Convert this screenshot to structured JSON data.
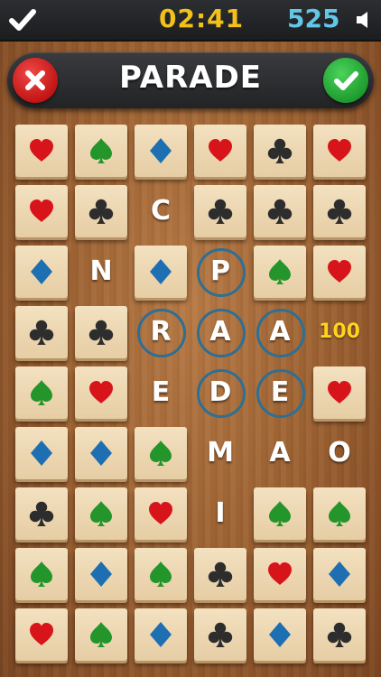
{
  "topbar": {
    "timer": "02:41",
    "score": "525"
  },
  "word": "PARADE",
  "colors": {
    "heart": "#d8141b",
    "spade": "#23952a",
    "diamond": "#1d6fb2",
    "club": "#2d2d2d",
    "timer": "#f2c21a",
    "score": "#62c6e6"
  },
  "grid": [
    [
      {
        "t": "heart"
      },
      {
        "t": "spade"
      },
      {
        "t": "diamond"
      },
      {
        "t": "heart"
      },
      {
        "t": "club"
      },
      {
        "t": "heart"
      }
    ],
    [
      {
        "t": "heart"
      },
      {
        "t": "club"
      },
      {
        "l": "C"
      },
      {
        "t": "club"
      },
      {
        "t": "club"
      },
      {
        "t": "club"
      }
    ],
    [
      {
        "t": "diamond"
      },
      {
        "l": "N"
      },
      {
        "t": "diamond"
      },
      {
        "l": "P",
        "sel": true
      },
      {
        "t": "spade"
      },
      {
        "t": "heart"
      }
    ],
    [
      {
        "t": "club"
      },
      {
        "t": "club"
      },
      {
        "l": "R",
        "sel": true
      },
      {
        "l": "A",
        "sel": true
      },
      {
        "l": "A",
        "sel": true
      },
      {
        "p": "100"
      }
    ],
    [
      {
        "t": "spade"
      },
      {
        "t": "heart"
      },
      {
        "l": "E"
      },
      {
        "l": "D",
        "sel": true
      },
      {
        "l": "E",
        "sel": true
      },
      {
        "t": "heart"
      }
    ],
    [
      {
        "t": "diamond"
      },
      {
        "t": "diamond"
      },
      {
        "t": "spade"
      },
      {
        "l": "M"
      },
      {
        "l": "A"
      },
      {
        "l": "O"
      }
    ],
    [
      {
        "t": "club"
      },
      {
        "t": "spade"
      },
      {
        "t": "heart"
      },
      {
        "l": "I"
      },
      {
        "t": "spade"
      },
      {
        "t": "spade"
      }
    ],
    [
      {
        "t": "spade"
      },
      {
        "t": "diamond"
      },
      {
        "t": "spade"
      },
      {
        "t": "club"
      },
      {
        "t": "heart"
      },
      {
        "t": "diamond"
      }
    ],
    [
      {
        "t": "heart"
      },
      {
        "t": "spade"
      },
      {
        "t": "diamond"
      },
      {
        "t": "club"
      },
      {
        "t": "diamond"
      },
      {
        "t": "club"
      }
    ]
  ]
}
